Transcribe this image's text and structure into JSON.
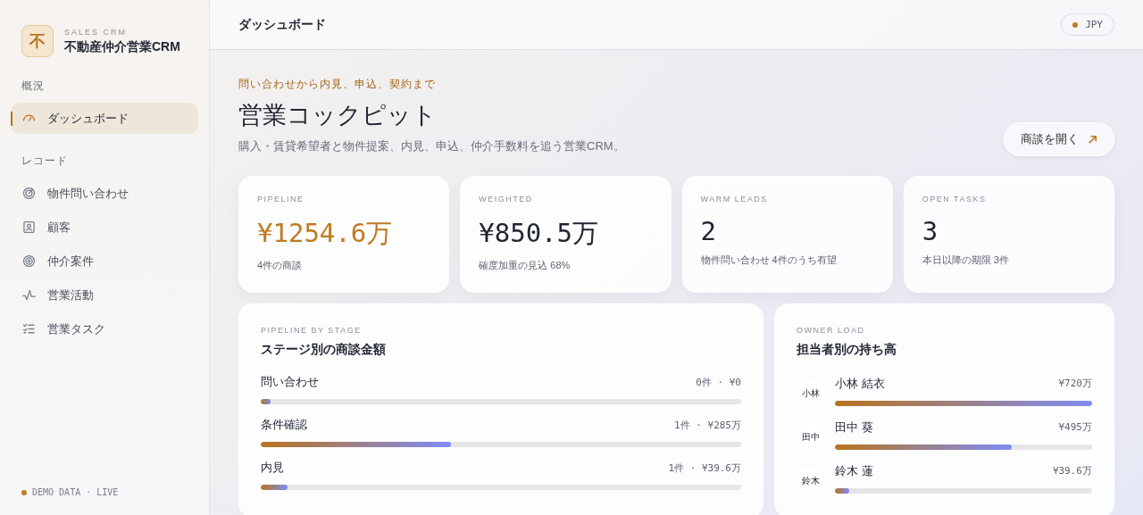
{
  "brand": {
    "logo": "不",
    "eyebrow": "SALES CRM",
    "name": "不動産仲介営業CRM"
  },
  "nav": [
    {
      "label": "概況",
      "items": [
        {
          "label": "ダッシュボード",
          "selected": true
        }
      ]
    },
    {
      "label": "レコード",
      "items": [
        {
          "label": "物件問い合わせ",
          "selected": false
        },
        {
          "label": "顧客",
          "selected": false
        },
        {
          "label": "仲介案件",
          "selected": false
        },
        {
          "label": "営業活動",
          "selected": false
        },
        {
          "label": "営業タスク",
          "selected": false
        }
      ]
    }
  ],
  "sidebar_footer": "DEMO DATA · LIVE",
  "header": {
    "title": "ダッシュボード",
    "currency": "JPY"
  },
  "hero": {
    "eyebrow": "問い合わせから内見、申込、契約まで",
    "title": "営業コックピット",
    "subtitle": "購入・賃貸希望者と物件提案、内見、申込、仲介手数料を追う営業CRM。",
    "button": "商談を開く"
  },
  "stats": [
    {
      "label": "PIPELINE",
      "value": "¥1254.6万",
      "note": "4件の商談",
      "kind": "accent"
    },
    {
      "label": "WEIGHTED",
      "value": "¥850.5万",
      "note": "確度加重の見込 68%",
      "kind": "plain"
    },
    {
      "label": "WARM LEADS",
      "value": "2",
      "note": "物件問い合わせ 4件のうち有望",
      "kind": "plain"
    },
    {
      "label": "OPEN TASKS",
      "value": "3",
      "note": "本日以降の期限 3件",
      "kind": "plain"
    }
  ],
  "stages": {
    "eyebrow": "PIPELINE BY STAGE",
    "title": "ステージ別の商談金額",
    "rows": [
      {
        "name": "問い合わせ",
        "reading": "0件 · ¥0",
        "level": 0.02
      },
      {
        "name": "条件確認",
        "reading": "1件 · ¥285万",
        "level": 0.396
      },
      {
        "name": "内見",
        "reading": "1件 · ¥39.6万",
        "level": 0.055
      }
    ]
  },
  "owners": {
    "eyebrow": "OWNER LOAD",
    "title": "担当者別の持ち高",
    "rows": [
      {
        "initials": "小林",
        "name": "小林 結衣",
        "reading": "¥720万",
        "level": 1.0
      },
      {
        "initials": "田中",
        "name": "田中 葵",
        "reading": "¥495万",
        "level": 0.6875
      },
      {
        "initials": "鈴木",
        "name": "鈴木 蓮",
        "reading": "¥39.6万",
        "level": 0.055
      }
    ]
  }
}
